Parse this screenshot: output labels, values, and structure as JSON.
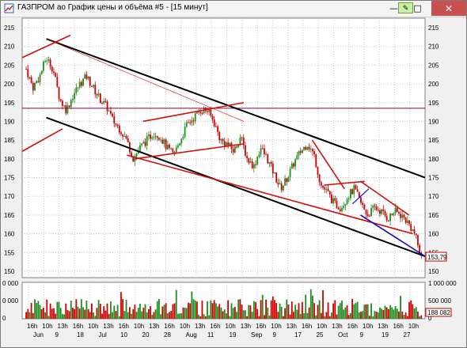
{
  "window": {
    "title": "ГАЗПРОМ ао График цены и объёма #5 - [15 минут]",
    "pin_icon": "pin-icon",
    "min_icon": "minimize-icon",
    "max_icon": "maximize-icon",
    "close_icon": "close-icon",
    "min_glyph": "—",
    "max_glyph": "□",
    "close_glyph": "✕"
  },
  "colors": {
    "plot_bg": "#ffffff",
    "grid": "#c8c8c8",
    "candle_up": "#1e8c1e",
    "candle_down": "#cc0000",
    "channel": "#000000",
    "trend_red": "#d01010",
    "trend_blue": "#1010c0",
    "price_label": "#cc0000"
  },
  "price_axis": {
    "labels": [
      "215",
      "210",
      "205",
      "200",
      "195",
      "190",
      "185",
      "180",
      "175",
      "170",
      "165",
      "160",
      "155",
      "150"
    ],
    "current_price": "153,79"
  },
  "volume_axis": {
    "left_labels": [
      "0 000",
      "0 000",
      "0"
    ],
    "right_labels": [
      "1 000 000",
      "500 000",
      "0"
    ],
    "current_volume": "188 082"
  },
  "time_axis": {
    "top_row": [
      "16h",
      "10h",
      "13h",
      "16h",
      "10h",
      "13h",
      "16h",
      "10h",
      "13h",
      "16h",
      "10h",
      "13h",
      "16h",
      "10h",
      "13h",
      "16h",
      "10h",
      "13h",
      "16h",
      "10h",
      "13h",
      "16h",
      "10h",
      "13h",
      "16h",
      "10h"
    ],
    "bottom_row": [
      "Jun",
      "9",
      "18",
      "Jul",
      "10",
      "20",
      "28",
      "Aug",
      "11",
      "19",
      "Sep",
      "9",
      "17",
      "25",
      "Oct",
      "9",
      "19",
      "27"
    ]
  },
  "chart_data": {
    "type": "candlestick",
    "y_axis": {
      "min": 150,
      "max": 215
    },
    "price_path": [
      204,
      199,
      202,
      207,
      204,
      196,
      193,
      197,
      200,
      202,
      199,
      196,
      194,
      190,
      188,
      185,
      180,
      183,
      185,
      187,
      186,
      183,
      181,
      185,
      189,
      191,
      193,
      193,
      190,
      185,
      184,
      182,
      186,
      180,
      178,
      183,
      180,
      176,
      172,
      175,
      179,
      182,
      184,
      181,
      173,
      171,
      168,
      167,
      170,
      172,
      168,
      165,
      167,
      166,
      164,
      166,
      165,
      163,
      160,
      153.79
    ],
    "hline": 193.5
  }
}
